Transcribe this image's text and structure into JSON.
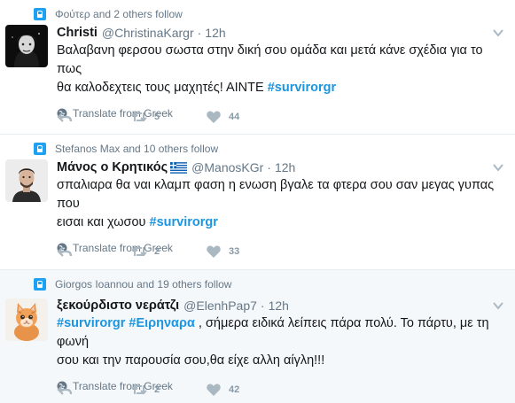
{
  "tweets": [
    {
      "context": "Φούτερ and 2 others follow",
      "name": "Christi",
      "handle": "@ChristinaKargr",
      "time": "12h",
      "text_lines": [
        "Βαλαβανη φερσου σωστα στην δική σου ομάδα και μετά κάνε σχέδια για το πως",
        "θα καλοδεχτεις τους μαχητές! ΑΙΝΤΕ "
      ],
      "hashtag": "#survirorgr",
      "translate": "Translate from Greek",
      "retweets": "5",
      "likes": "44"
    },
    {
      "context": "Stefanos Max and 10 others follow",
      "name": "Μάνος ο Κρητικός",
      "handle": "@ManosKGr",
      "time": "12h",
      "text_lines": [
        "σπαλιαρα θα ναι κλαμπ φαση η ενωση βγαλε τα φτερα σου σαν μεγας γυπας που",
        "εισαι και χωσου "
      ],
      "hashtag": "#survirorgr",
      "translate": "Translate from Greek",
      "retweets": "2",
      "likes": "33"
    },
    {
      "context": "Giorgos Ioannou and 19 others follow",
      "name": "ξεκούρδιστο νεράτζι",
      "handle": "@ElenhPap7",
      "time": "12h",
      "hashtag1": "#survirorgr",
      "hashtag2": "#Ειρηναρα",
      "text_line1_rest": " , σήμερα ειδικά λείπεις πάρα πολύ. Το πάρτυ, με τη φωνή",
      "text_line2": "σου και την παρουσία σου,θα είχε αλλη αίγλη!!!",
      "translate": "Translate from Greek",
      "retweets": "2",
      "likes": "42"
    }
  ],
  "icons": {
    "context": "follow-context-icon",
    "reply": "reply-icon",
    "retweet": "retweet-icon",
    "like": "heart-icon",
    "globe": "globe-icon",
    "chevron": "chevron-down-icon",
    "flag": "greece-flag-icon"
  },
  "colors": {
    "link": "#1b95e0",
    "muted": "#657786",
    "action": "#aab8c2",
    "brand": "#1da1f2",
    "highlight_bg": "#f5f8fa"
  }
}
